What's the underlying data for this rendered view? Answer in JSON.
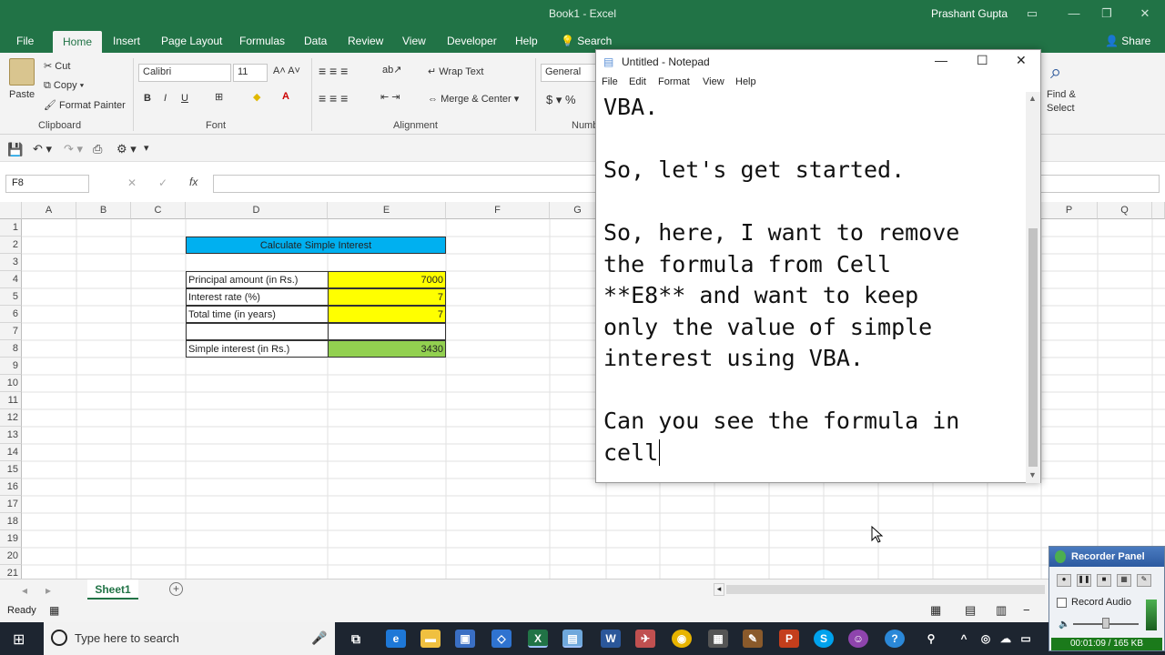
{
  "excel": {
    "window_title": "Book1 - Excel",
    "user": "Prashant Gupta",
    "tabs": [
      "File",
      "Home",
      "Insert",
      "Page Layout",
      "Formulas",
      "Data",
      "Review",
      "View",
      "Developer",
      "Help",
      "Search"
    ],
    "share": "Share",
    "clipboard": {
      "paste": "Paste",
      "cut": "Cut",
      "copy": "Copy",
      "format_painter": "Format Painter",
      "group": "Clipboard"
    },
    "font": {
      "name": "Calibri",
      "size": "11",
      "group": "Font"
    },
    "alignment": {
      "wrap": "Wrap Text",
      "merge": "Merge & Center",
      "group": "Alignment"
    },
    "number": {
      "format": "General",
      "group": "Numb"
    },
    "editing": {
      "find_select_1": "Find &",
      "find_select_2": "Select"
    },
    "namebox": "F8",
    "fx": "fx",
    "columns": [
      "A",
      "B",
      "C",
      "D",
      "E",
      "F",
      "G",
      "P",
      "Q"
    ],
    "rows": [
      "1",
      "2",
      "3",
      "4",
      "5",
      "6",
      "7",
      "8",
      "9",
      "10",
      "11",
      "12",
      "13",
      "14",
      "15",
      "16",
      "17",
      "18",
      "19",
      "20",
      "21"
    ],
    "cells": {
      "header": "Calculate Simple Interest",
      "principal_label": "Principal amount (in Rs.)",
      "principal_value": "7000",
      "rate_label": "Interest rate (%)",
      "rate_value": "7",
      "time_label": "Total time (in years)",
      "time_value": "7",
      "si_label": "Simple interest (in Rs.)",
      "si_value": "3430"
    },
    "sheet_tab": "Sheet1",
    "status": "Ready",
    "colors": {
      "accent": "#217346",
      "header_fill": "#00b0f0",
      "input_fill": "#ffff00",
      "result_fill": "#92d050"
    }
  },
  "notepad": {
    "title": "Untitled - Notepad",
    "menu": [
      "File",
      "Edit",
      "Format",
      "View",
      "Help"
    ],
    "text": "VBA.\n\nSo, let's get started.\n\nSo, here, I want to remove\nthe formula from Cell\n**E8** and want to keep\nonly the value of simple\ninterest using VBA.\n\nCan you see the formula in\ncell"
  },
  "taskbar": {
    "search_placeholder": "Type here to search"
  },
  "recorder": {
    "title": "Recorder Panel",
    "record_audio": "Record Audio",
    "timer": "00:01:09 / 165 KB"
  }
}
